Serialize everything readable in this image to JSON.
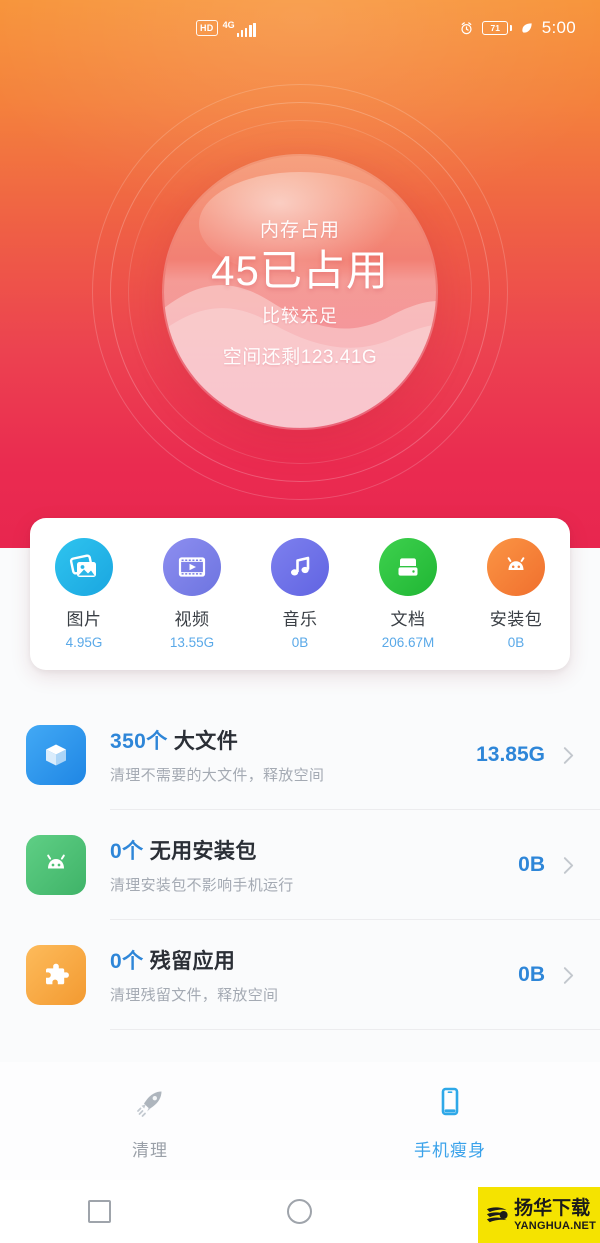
{
  "statusbar": {
    "hd_badge": "HD",
    "network": "4G",
    "signal_icon": "signal-bars-icon",
    "alarm_icon": "alarm-clock-icon",
    "battery_level": "71",
    "power_saving_icon": "leaf-icon",
    "time": "5:00"
  },
  "gauge": {
    "label": "内存占用",
    "main": "45已占用",
    "status": "比较充足",
    "free_space": "空间还剩123.41G"
  },
  "categories": [
    {
      "name": "图片",
      "size": "4.95G",
      "icon": "photos-icon",
      "color": "#29b6e8"
    },
    {
      "name": "视频",
      "size": "13.55G",
      "icon": "video-icon",
      "color": "#7b7fe4"
    },
    {
      "name": "音乐",
      "size": "0B",
      "icon": "music-icon",
      "color": "#6c6fe8"
    },
    {
      "name": "文档",
      "size": "206.67M",
      "icon": "document-drive-icon",
      "color": "#2fbf3f"
    },
    {
      "name": "安装包",
      "size": "0B",
      "icon": "android-package-icon",
      "color": "#f5813c"
    }
  ],
  "list": [
    {
      "count": "350个",
      "title": "大文件",
      "desc": "清理不需要的大文件，释放空间",
      "value": "13.85G",
      "icon": "cube-box-icon",
      "color": "#2e9bf0",
      "chevron": "chevron-right-icon"
    },
    {
      "count": "0个",
      "title": "无用安装包",
      "desc": "清理安装包不影响手机运行",
      "value": "0B",
      "icon": "android-robot-icon",
      "color": "#4ec275",
      "chevron": "chevron-right-icon"
    },
    {
      "count": "0个",
      "title": "残留应用",
      "desc": "清理残留文件，释放空间",
      "value": "0B",
      "icon": "puzzle-piece-icon",
      "color": "#f6a942",
      "chevron": "chevron-right-icon"
    }
  ],
  "tabs": [
    {
      "label": "清理",
      "icon": "rocket-icon",
      "active": false
    },
    {
      "label": "手机瘦身",
      "icon": "phone-icon",
      "active": true
    }
  ],
  "navbar": {
    "recents_icon": "square-recents-icon",
    "home_icon": "circle-home-icon",
    "back_icon": "triangle-back-icon"
  },
  "watermark": {
    "cn": "扬华下载",
    "en": "YANGHUA.NET"
  },
  "colors": {
    "gradient_top": "#f7943a",
    "gradient_bottom": "#e8264f",
    "accent_blue": "#2e86d8",
    "tab_active": "#3aa2ea",
    "watermark_bg": "#f5e300"
  }
}
